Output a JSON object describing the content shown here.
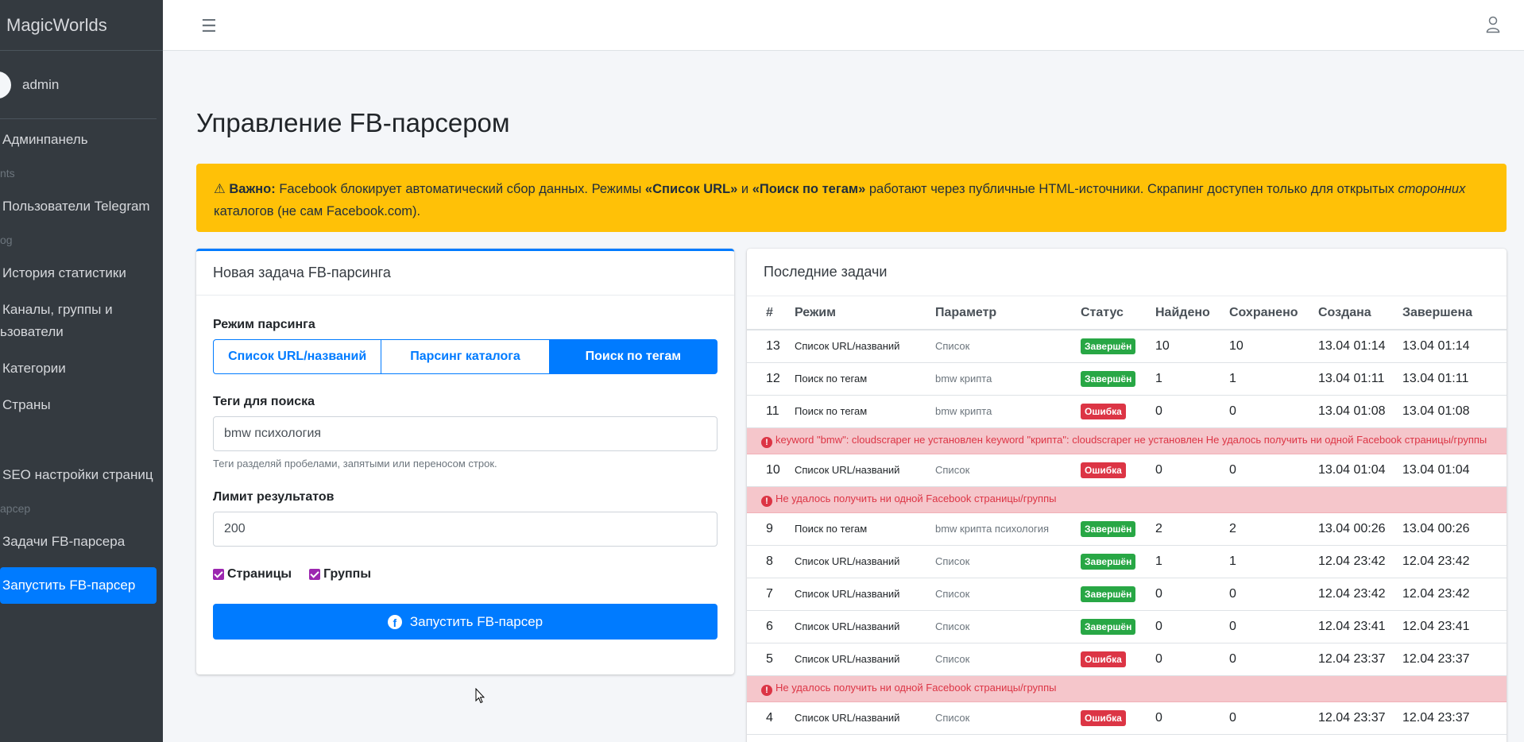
{
  "brand": "MagicWorlds",
  "user": {
    "name": "admin"
  },
  "nav": [
    {
      "type": "item",
      "label": "Админпанель",
      "icon": "dashboard-icon"
    },
    {
      "type": "header",
      "label": "nts"
    },
    {
      "type": "item",
      "label": "Пользователи Telegram",
      "icon": "users-icon"
    },
    {
      "type": "header",
      "label": "og"
    },
    {
      "type": "item",
      "label": "История статистики",
      "icon": "history-icon"
    },
    {
      "type": "item",
      "label": "Каналы, группы и",
      "label2": "ьзователи",
      "icon": "channels-icon"
    },
    {
      "type": "item",
      "label": "Категории",
      "icon": "categories-icon"
    },
    {
      "type": "item",
      "label": "Страны",
      "icon": "flag-icon"
    },
    {
      "type": "item",
      "label": "SEO настройки страниц",
      "icon": "seo-icon"
    },
    {
      "type": "header",
      "label": "арсер"
    },
    {
      "type": "item",
      "label": "Задачи FB-парсера",
      "icon": "tasks-icon"
    },
    {
      "type": "item",
      "label": "Запустить FB-парсер",
      "icon": "play-icon",
      "active": true
    }
  ],
  "page": {
    "title": "Управление FB-парсером"
  },
  "alert": {
    "strong": "Важно:",
    "t1": " Facebook блокирует автоматический сбор данных. Режимы ",
    "m1": "«Список URL»",
    "t2": " и ",
    "m2": "«Поиск по тегам»",
    "t3": " работают через публичные HTML-источники. Скрапинг доступен только для открытых ",
    "em": "сторонних",
    "t4": " каталогов (не сам Facebook.com)."
  },
  "form": {
    "card_title": "Новая задача FB-парсинга",
    "mode_label": "Режим парсинга",
    "modes": [
      "Список URL/названий",
      "Парсинг каталога",
      "Поиск по тегам"
    ],
    "tags_label": "Теги для поиска",
    "tags_value": "bmw психология",
    "tags_hint": "Теги разделяй пробелами, запятыми или переносом строк.",
    "limit_label": "Лимит результатов",
    "limit_value": "200",
    "check_pages": "Страницы",
    "check_groups": "Группы",
    "submit": "Запустить FB-парсер"
  },
  "tasks": {
    "card_title": "Последние задачи",
    "columns": [
      "#",
      "Режим",
      "Параметр",
      "Статус",
      "Найдено",
      "Сохранено",
      "Создана",
      "Завершена"
    ],
    "rows": [
      {
        "id": "13",
        "mode": "Список URL/названий",
        "param": "Список",
        "status": "Завершён",
        "ok": true,
        "found": "10",
        "saved": "10",
        "created": "13.04 01:14",
        "done": "13.04 01:14"
      },
      {
        "id": "12",
        "mode": "Поиск по тегам",
        "param": "bmw крипта",
        "status": "Завершён",
        "ok": true,
        "found": "1",
        "saved": "1",
        "created": "13.04 01:11",
        "done": "13.04 01:11"
      },
      {
        "id": "11",
        "mode": "Поиск по тегам",
        "param": "bmw крипта",
        "status": "Ошибка",
        "ok": false,
        "found": "0",
        "saved": "0",
        "created": "13.04 01:08",
        "done": "13.04 01:08",
        "error": "keyword \"bmw\": cloudscraper не установлен keyword \"крипта\": cloudscraper не установлен Не удалось получить ни одной Facebook страницы/группы"
      },
      {
        "id": "10",
        "mode": "Список URL/названий",
        "param": "Список",
        "status": "Ошибка",
        "ok": false,
        "found": "0",
        "saved": "0",
        "created": "13.04 01:04",
        "done": "13.04 01:04",
        "error": "Не удалось получить ни одной Facebook страницы/группы"
      },
      {
        "id": "9",
        "mode": "Поиск по тегам",
        "param": "bmw крипта психология",
        "status": "Завершён",
        "ok": true,
        "found": "2",
        "saved": "2",
        "created": "13.04 00:26",
        "done": "13.04 00:26"
      },
      {
        "id": "8",
        "mode": "Список URL/названий",
        "param": "Список",
        "status": "Завершён",
        "ok": true,
        "found": "1",
        "saved": "1",
        "created": "12.04 23:42",
        "done": "12.04 23:42"
      },
      {
        "id": "7",
        "mode": "Список URL/названий",
        "param": "Список",
        "status": "Завершён",
        "ok": true,
        "found": "0",
        "saved": "0",
        "created": "12.04 23:42",
        "done": "12.04 23:42"
      },
      {
        "id": "6",
        "mode": "Список URL/названий",
        "param": "Список",
        "status": "Завершён",
        "ok": true,
        "found": "0",
        "saved": "0",
        "created": "12.04 23:41",
        "done": "12.04 23:41"
      },
      {
        "id": "5",
        "mode": "Список URL/названий",
        "param": "Список",
        "status": "Ошибка",
        "ok": false,
        "found": "0",
        "saved": "0",
        "created": "12.04 23:37",
        "done": "12.04 23:37",
        "error": "Не удалось получить ни одной Facebook страницы/группы"
      },
      {
        "id": "4",
        "mode": "Список URL/названий",
        "param": "Список",
        "status": "Ошибка",
        "ok": false,
        "found": "0",
        "saved": "0",
        "created": "12.04 23:37",
        "done": "12.04 23:37"
      }
    ]
  }
}
